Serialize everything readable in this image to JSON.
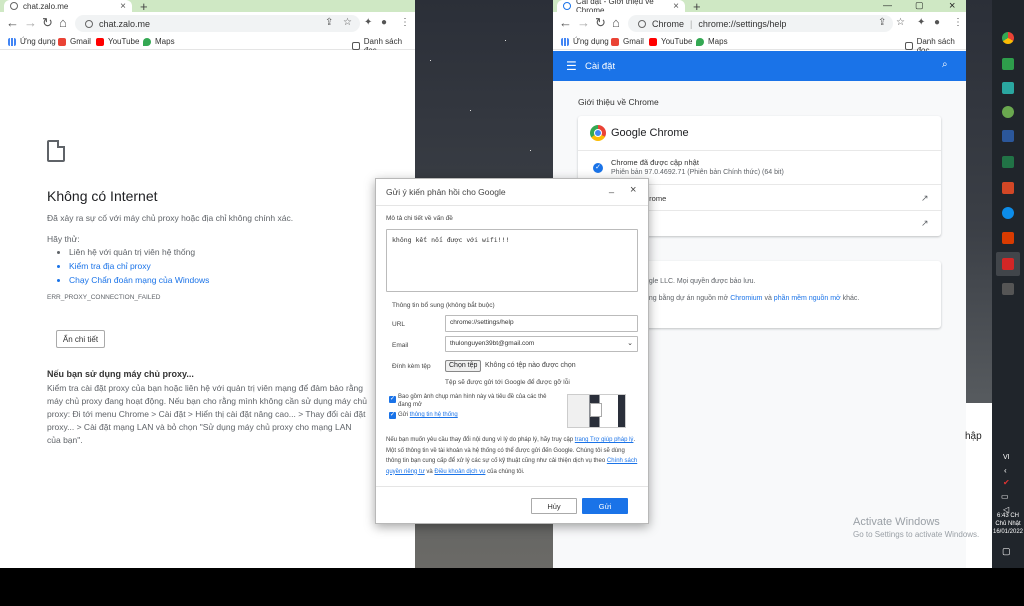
{
  "left_browser": {
    "tab_title": "chat.zalo.me",
    "url": "chat.zalo.me",
    "bookmarks": [
      "Ứng dụng",
      "Gmail",
      "YouTube",
      "Maps"
    ],
    "reading_list": "Danh sách đọc",
    "error": {
      "title": "Không có Internet",
      "desc": "Đã xảy ra sự cố với máy chủ proxy hoặc địa chỉ không chính xác.",
      "try_label": "Hãy thử:",
      "suggestions": [
        "Liên hệ với quản trị viên hệ thống",
        "Kiểm tra địa chỉ proxy",
        "Chạy Chẩn đoán mạng của Windows"
      ],
      "code": "ERR_PROXY_CONNECTION_FAILED",
      "details_button": "Ẩn chi tiết",
      "proxy_title": "Nếu bạn sử dụng máy chủ proxy...",
      "proxy_text": "Kiểm tra cài đặt proxy của bạn hoặc liên hệ với quản trị viên mạng để đảm bảo rằng máy chủ proxy đang hoạt động. Nếu bạn cho rằng mình không cần sử dụng máy chủ proxy: Đi tới menu Chrome > Cài đặt > Hiển thị cài đặt nâng cao... > Thay đổi cài đặt proxy... > Cài đặt mạng LAN và bỏ chọn \"Sử dụng máy chủ proxy cho mạng LAN của bạn\"."
    }
  },
  "right_browser": {
    "tab_title": "Cài đặt - Giới thiệu về Chrome",
    "url_scheme": "Chrome",
    "url": "chrome://settings/help",
    "bookmarks": [
      "Ứng dụng",
      "Gmail",
      "YouTube",
      "Maps"
    ],
    "reading_list": "Danh sách đọc",
    "header_title": "Cài đặt",
    "section_title": "Giới thiệu về Chrome",
    "product_name": "Google Chrome",
    "update_status": "Chrome đã được cập nhật",
    "version": "Phiên bản 97.0.4692.71 (Phiên bản Chính thức) (64 bit)",
    "row1_tail": "hrome",
    "copyright_tail": "ogle LLC. Mọi quyền được bảo lưu.",
    "open_source_pre": "ụng bằng dự án nguồn mở",
    "chromium": "Chromium",
    "and_word": "và",
    "open_source_link": "phần mềm nguồn mở",
    "open_source_post": "khác."
  },
  "dialog": {
    "title": "Gửi ý kiến phản hồi cho Google",
    "describe_label": "Mô tả chi tiết về vấn đề",
    "describe_value": "không kết nối được với wifi!!!",
    "additional_label": "Thông tin bổ sung (không bắt buộc)",
    "url_label": "URL",
    "url_value": "chrome://settings/help",
    "email_label": "Email",
    "email_value": "thulonguyen39bt@gmail.com",
    "attach_label": "Đính kèm tệp",
    "choose_file": "Chọn tệp",
    "no_file": "Không có tệp nào được chọn",
    "files_note": "Tệp sẽ được gửi tới Google để được gỡ lỗi",
    "screenshot_check": "Bao gồm ảnh chụp màn hình này và tiêu đề của các thẻ đang mở",
    "sysinfo_pre": "Gửi",
    "sysinfo_link": "thông tin hệ thống",
    "legal_pre": "Nếu bạn muốn yêu cầu thay đổi nội dung vì lý do pháp lý, hãy truy cập",
    "legal_link": "trang Trợ giúp pháp lý",
    "legal_mid": ". Một số thông tin về tài khoản và hệ thống có thể được gửi đến Google. Chúng tôi sẽ dùng thông tin bạn cung cấp để xử lý các sự cố kỹ thuật cũng như cải thiện dịch vụ theo",
    "privacy_link": "Chính sách quyền riêng tư",
    "and_word": "và",
    "terms_link": "Điều khoản dịch vụ",
    "legal_end": "của chúng tôi.",
    "cancel": "Hủy",
    "send": "Gửi"
  },
  "desktop": {
    "activate_title": "Activate Windows",
    "activate_sub": "Go to Settings to activate Windows.",
    "partial_text": "hập",
    "clock_time": "6:43 CH",
    "clock_day": "Chủ Nhật",
    "clock_date": "16/01/2022",
    "lang": "VI"
  },
  "colors": {
    "accent": "#1a73e8",
    "tabstrip": "#cfe8c4"
  }
}
